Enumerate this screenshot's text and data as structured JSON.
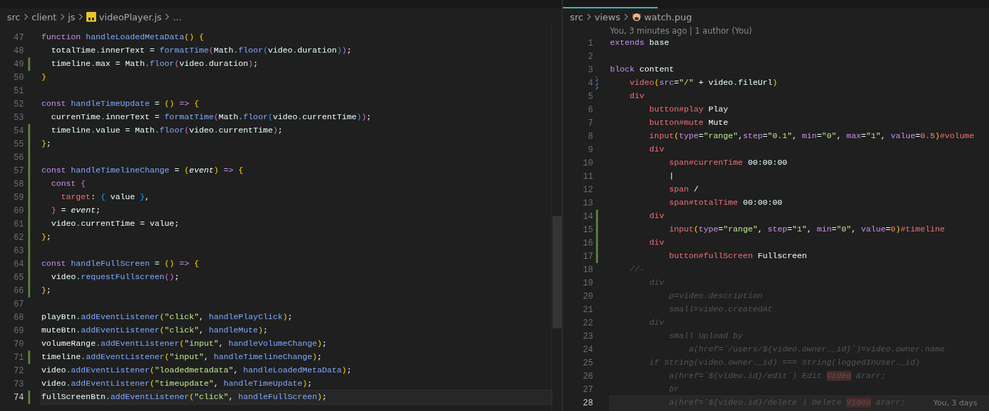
{
  "panes": [
    {
      "breadcrumbs": [
        {
          "label": "src",
          "kind": "folder"
        },
        {
          "label": "client",
          "kind": "folder"
        },
        {
          "label": "js",
          "kind": "folder"
        },
        {
          "label": "videoPlayer.js",
          "kind": "js-file"
        },
        {
          "label": "...",
          "kind": "more"
        }
      ],
      "lines": [
        {
          "number": "47",
          "kind": "plain",
          "current": false,
          "tokens": [
            {
              "text": "function ",
              "kind": "kw"
            },
            {
              "text": "handleLoadedMetaData",
              "kind": "fn"
            },
            {
              "text": "() {",
              "kind": "b1"
            }
          ]
        },
        {
          "number": "48",
          "kind": "plain",
          "current": false,
          "tokens": [
            {
              "text": "  totalTime",
              "kind": "v"
            },
            {
              "text": ".",
              "kind": "p"
            },
            {
              "text": "innerText = ",
              "kind": "v"
            },
            {
              "text": "formatTime",
              "kind": "fn"
            },
            {
              "text": "(",
              "kind": "b2"
            },
            {
              "text": "Math",
              "kind": "v"
            },
            {
              "text": ".",
              "kind": "p"
            },
            {
              "text": "floor",
              "kind": "fn"
            },
            {
              "text": "(",
              "kind": "b3"
            },
            {
              "text": "video",
              "kind": "v"
            },
            {
              "text": ".",
              "kind": "p"
            },
            {
              "text": "duration",
              "kind": "v"
            },
            {
              "text": ")",
              "kind": "b3"
            },
            {
              "text": ")",
              "kind": "b2"
            },
            {
              "text": ";",
              "kind": "v"
            }
          ]
        },
        {
          "number": "49",
          "kind": "modified",
          "current": false,
          "tokens": [
            {
              "text": "  timeline",
              "kind": "v"
            },
            {
              "text": ".",
              "kind": "p"
            },
            {
              "text": "max = Math",
              "kind": "v"
            },
            {
              "text": ".",
              "kind": "p"
            },
            {
              "text": "floor",
              "kind": "fn"
            },
            {
              "text": "(",
              "kind": "b2"
            },
            {
              "text": "video",
              "kind": "v"
            },
            {
              "text": ".",
              "kind": "p"
            },
            {
              "text": "duration",
              "kind": "v"
            },
            {
              "text": ")",
              "kind": "b2"
            },
            {
              "text": ";",
              "kind": "v"
            }
          ]
        },
        {
          "number": "50",
          "kind": "plain",
          "current": false,
          "tokens": [
            {
              "text": "}",
              "kind": "b1"
            }
          ]
        },
        {
          "number": "51",
          "kind": "plain",
          "current": false
        },
        {
          "number": "52",
          "kind": "plain",
          "current": false,
          "tokens": [
            {
              "text": "const ",
              "kind": "kw"
            },
            {
              "text": "handleTimeUpdate",
              "kind": "fn"
            },
            {
              "text": " = ",
              "kind": "v"
            },
            {
              "text": "()",
              "kind": "b1"
            },
            {
              "text": " => ",
              "kind": "kw"
            },
            {
              "text": "{",
              "kind": "b1"
            }
          ]
        },
        {
          "number": "53",
          "kind": "plain",
          "current": false,
          "tokens": [
            {
              "text": "  currenTime",
              "kind": "v"
            },
            {
              "text": ".",
              "kind": "p"
            },
            {
              "text": "innerText = ",
              "kind": "v"
            },
            {
              "text": "formatTime",
              "kind": "fn"
            },
            {
              "text": "(",
              "kind": "b2"
            },
            {
              "text": "Math",
              "kind": "v"
            },
            {
              "text": ".",
              "kind": "p"
            },
            {
              "text": "floor",
              "kind": "fn"
            },
            {
              "text": "(",
              "kind": "b3"
            },
            {
              "text": "video",
              "kind": "v"
            },
            {
              "text": ".",
              "kind": "p"
            },
            {
              "text": "currentTime",
              "kind": "v"
            },
            {
              "text": ")",
              "kind": "b3"
            },
            {
              "text": ")",
              "kind": "b2"
            },
            {
              "text": ";",
              "kind": "v"
            }
          ]
        },
        {
          "number": "54",
          "kind": "modified",
          "current": false,
          "tokens": [
            {
              "text": "  timeline",
              "kind": "v"
            },
            {
              "text": ".",
              "kind": "p"
            },
            {
              "text": "value = Math",
              "kind": "v"
            },
            {
              "text": ".",
              "kind": "p"
            },
            {
              "text": "floor",
              "kind": "fn"
            },
            {
              "text": "(",
              "kind": "b2"
            },
            {
              "text": "video",
              "kind": "v"
            },
            {
              "text": ".",
              "kind": "p"
            },
            {
              "text": "currentTime",
              "kind": "v"
            },
            {
              "text": ")",
              "kind": "b2"
            },
            {
              "text": ";",
              "kind": "v"
            }
          ]
        },
        {
          "number": "55",
          "kind": "modified",
          "current": false,
          "tokens": [
            {
              "text": "}",
              "kind": "b1"
            },
            {
              "text": ";",
              "kind": "v"
            }
          ]
        },
        {
          "number": "56",
          "kind": "modified",
          "current": false
        },
        {
          "number": "57",
          "kind": "modified",
          "current": false,
          "tokens": [
            {
              "text": "const ",
              "kind": "kw"
            },
            {
              "text": "handleTimelineChange",
              "kind": "fn"
            },
            {
              "text": " = ",
              "kind": "v"
            },
            {
              "text": "(",
              "kind": "b1"
            },
            {
              "text": "event",
              "kind": "it"
            },
            {
              "text": ")",
              "kind": "b1"
            },
            {
              "text": " => ",
              "kind": "kw"
            },
            {
              "text": "{",
              "kind": "b1"
            }
          ]
        },
        {
          "number": "58",
          "kind": "modified",
          "current": false,
          "tokens": [
            {
              "text": "  const ",
              "kind": "kw"
            },
            {
              "text": "{",
              "kind": "b2"
            }
          ]
        },
        {
          "number": "59",
          "kind": "modified",
          "current": false,
          "tokens": [
            {
              "text": "    target",
              "kind": "prop"
            },
            {
              "text": ": ",
              "kind": "v"
            },
            {
              "text": "{",
              "kind": "b3"
            },
            {
              "text": " value ",
              "kind": "v"
            },
            {
              "text": "}",
              "kind": "b3"
            },
            {
              "text": ",",
              "kind": "v"
            }
          ]
        },
        {
          "number": "60",
          "kind": "modified",
          "current": false,
          "tokens": [
            {
              "text": "  }",
              "kind": "b2"
            },
            {
              "text": " = ",
              "kind": "v"
            },
            {
              "text": "event",
              "kind": "it"
            },
            {
              "text": ";",
              "kind": "v"
            }
          ]
        },
        {
          "number": "61",
          "kind": "modified",
          "current": false,
          "tokens": [
            {
              "text": "  video",
              "kind": "v"
            },
            {
              "text": ".",
              "kind": "p"
            },
            {
              "text": "currentTime = value;",
              "kind": "v"
            }
          ]
        },
        {
          "number": "62",
          "kind": "modified",
          "current": false,
          "tokens": [
            {
              "text": "}",
              "kind": "b1"
            },
            {
              "text": ";",
              "kind": "v"
            }
          ]
        },
        {
          "number": "63",
          "kind": "modified",
          "current": false
        },
        {
          "number": "64",
          "kind": "modified",
          "current": false,
          "tokens": [
            {
              "text": "const ",
              "kind": "kw"
            },
            {
              "text": "handleFullScreen",
              "kind": "fn"
            },
            {
              "text": " = ",
              "kind": "v"
            },
            {
              "text": "()",
              "kind": "b1"
            },
            {
              "text": " => ",
              "kind": "kw"
            },
            {
              "text": "{",
              "kind": "b1"
            }
          ]
        },
        {
          "number": "65",
          "kind": "modified",
          "current": false,
          "tokens": [
            {
              "text": "  video",
              "kind": "v"
            },
            {
              "text": ".",
              "kind": "p"
            },
            {
              "text": "requestFullscreen",
              "kind": "fn"
            },
            {
              "text": "()",
              "kind": "b2"
            },
            {
              "text": ";",
              "kind": "v"
            }
          ]
        },
        {
          "number": "66",
          "kind": "modified",
          "current": false,
          "tokens": [
            {
              "text": "}",
              "kind": "b1"
            },
            {
              "text": ";",
              "kind": "v"
            }
          ]
        },
        {
          "number": "67",
          "kind": "plain",
          "current": false
        },
        {
          "number": "68",
          "kind": "plain",
          "current": false,
          "tokens": [
            {
              "text": "playBtn",
              "kind": "v"
            },
            {
              "text": ".",
              "kind": "p"
            },
            {
              "text": "addEventListener",
              "kind": "fn"
            },
            {
              "text": "(",
              "kind": "b1"
            },
            {
              "text": "\"click\"",
              "kind": "s"
            },
            {
              "text": ", ",
              "kind": "v"
            },
            {
              "text": "handlePlayClick",
              "kind": "fn"
            },
            {
              "text": ")",
              "kind": "b1"
            },
            {
              "text": ";",
              "kind": "v"
            }
          ]
        },
        {
          "number": "69",
          "kind": "plain",
          "current": false,
          "tokens": [
            {
              "text": "muteBtn",
              "kind": "v"
            },
            {
              "text": ".",
              "kind": "p"
            },
            {
              "text": "addEventListener",
              "kind": "fn"
            },
            {
              "text": "(",
              "kind": "b1"
            },
            {
              "text": "\"click\"",
              "kind": "s"
            },
            {
              "text": ", ",
              "kind": "v"
            },
            {
              "text": "handleMute",
              "kind": "fn"
            },
            {
              "text": ")",
              "kind": "b1"
            },
            {
              "text": ";",
              "kind": "v"
            }
          ]
        },
        {
          "number": "70",
          "kind": "plain",
          "current": false,
          "tokens": [
            {
              "text": "volumeRange",
              "kind": "v"
            },
            {
              "text": ".",
              "kind": "p"
            },
            {
              "text": "addEventListener",
              "kind": "fn"
            },
            {
              "text": "(",
              "kind": "b1"
            },
            {
              "text": "\"input\"",
              "kind": "s"
            },
            {
              "text": ", ",
              "kind": "v"
            },
            {
              "text": "handleVolumeChange",
              "kind": "fn"
            },
            {
              "text": ")",
              "kind": "b1"
            },
            {
              "text": ";",
              "kind": "v"
            }
          ]
        },
        {
          "number": "71",
          "kind": "modified",
          "current": false,
          "tokens": [
            {
              "text": "timeline",
              "kind": "v"
            },
            {
              "text": ".",
              "kind": "p"
            },
            {
              "text": "addEventListener",
              "kind": "fn"
            },
            {
              "text": "(",
              "kind": "b1"
            },
            {
              "text": "\"input\"",
              "kind": "s"
            },
            {
              "text": ", ",
              "kind": "v"
            },
            {
              "text": "handleTimelineChange",
              "kind": "fn"
            },
            {
              "text": ")",
              "kind": "b1"
            },
            {
              "text": ";",
              "kind": "v"
            }
          ]
        },
        {
          "number": "72",
          "kind": "plain",
          "current": false,
          "tokens": [
            {
              "text": "video",
              "kind": "v"
            },
            {
              "text": ".",
              "kind": "p"
            },
            {
              "text": "addEventListener",
              "kind": "fn"
            },
            {
              "text": "(",
              "kind": "b1"
            },
            {
              "text": "\"loadedmetadata\"",
              "kind": "s"
            },
            {
              "text": ", ",
              "kind": "v"
            },
            {
              "text": "handleLoadedMetaData",
              "kind": "fn"
            },
            {
              "text": ")",
              "kind": "b1"
            },
            {
              "text": ";",
              "kind": "v"
            }
          ]
        },
        {
          "number": "73",
          "kind": "plain",
          "current": false,
          "tokens": [
            {
              "text": "video",
              "kind": "v"
            },
            {
              "text": ".",
              "kind": "p"
            },
            {
              "text": "addEventListener",
              "kind": "fn"
            },
            {
              "text": "(",
              "kind": "b1"
            },
            {
              "text": "\"timeupdate\"",
              "kind": "s"
            },
            {
              "text": ", ",
              "kind": "v"
            },
            {
              "text": "handleTimeUpdate",
              "kind": "fn"
            },
            {
              "text": ")",
              "kind": "b1"
            },
            {
              "text": ";",
              "kind": "v"
            }
          ]
        },
        {
          "number": "74",
          "kind": "modified",
          "current": true,
          "tokens": [
            {
              "text": "fullScreenBtn",
              "kind": "v"
            },
            {
              "text": ".",
              "kind": "p"
            },
            {
              "text": "addEventListener",
              "kind": "fn"
            },
            {
              "text": "(",
              "kind": "b1"
            },
            {
              "text": "\"click\"",
              "kind": "s"
            },
            {
              "text": ", ",
              "kind": "v"
            },
            {
              "text": "handleFullScreen",
              "kind": "fn"
            },
            {
              "text": ")",
              "kind": "b1"
            },
            {
              "text": ";",
              "kind": "v"
            }
          ]
        }
      ]
    },
    {
      "breadcrumbs": [
        {
          "label": "src",
          "kind": "folder"
        },
        {
          "label": "views",
          "kind": "folder"
        },
        {
          "label": "watch.pug",
          "kind": "pug-file"
        }
      ],
      "blame_header": "You, 3 minutes ago | 1 author (You)",
      "lines": [
        {
          "number": "1",
          "kind": "plain",
          "current": false,
          "tokens": [
            {
              "text": "extends ",
              "kind": "kw"
            },
            {
              "text": "base",
              "kind": "v"
            }
          ]
        },
        {
          "number": "2",
          "kind": "plain",
          "current": false
        },
        {
          "number": "3",
          "kind": "plain",
          "current": false,
          "tokens": [
            {
              "text": "block ",
              "kind": "kw"
            },
            {
              "text": "content",
              "kind": "v"
            }
          ]
        },
        {
          "number": "4",
          "kind": "dotted",
          "current": false,
          "tokens": [
            {
              "text": "    video",
              "kind": "tag"
            },
            {
              "text": "(",
              "kind": "b1"
            },
            {
              "text": "src",
              "kind": "attr"
            },
            {
              "text": "=",
              "kind": "v"
            },
            {
              "text": "\"/\"",
              "kind": "s"
            },
            {
              "text": " + video",
              "kind": "v"
            },
            {
              "text": ".",
              "kind": "p"
            },
            {
              "text": "fileUrl",
              "kind": "v"
            },
            {
              "text": ")",
              "kind": "b1"
            }
          ]
        },
        {
          "number": "5",
          "kind": "plain",
          "current": false,
          "tokens": [
            {
              "text": "    div",
              "kind": "tag"
            }
          ]
        },
        {
          "number": "6",
          "kind": "plain",
          "current": false,
          "tokens": [
            {
              "text": "        button#play ",
              "kind": "tag"
            },
            {
              "text": "Play",
              "kind": "v"
            }
          ]
        },
        {
          "number": "7",
          "kind": "plain",
          "current": false,
          "tokens": [
            {
              "text": "        button#mute ",
              "kind": "tag"
            },
            {
              "text": "Mute",
              "kind": "v"
            }
          ]
        },
        {
          "number": "8",
          "kind": "plain",
          "current": false,
          "tokens": [
            {
              "text": "        input",
              "kind": "tag"
            },
            {
              "text": "(",
              "kind": "b1"
            },
            {
              "text": "type",
              "kind": "attr"
            },
            {
              "text": "=",
              "kind": "v"
            },
            {
              "text": "\"range\"",
              "kind": "s"
            },
            {
              "text": ",",
              "kind": "v"
            },
            {
              "text": "step",
              "kind": "attr"
            },
            {
              "text": "=",
              "kind": "v"
            },
            {
              "text": "\"0.1\"",
              "kind": "s"
            },
            {
              "text": ", ",
              "kind": "v"
            },
            {
              "text": "min",
              "kind": "attr"
            },
            {
              "text": "=",
              "kind": "v"
            },
            {
              "text": "\"0\"",
              "kind": "s"
            },
            {
              "text": ", ",
              "kind": "v"
            },
            {
              "text": "max",
              "kind": "attr"
            },
            {
              "text": "=",
              "kind": "v"
            },
            {
              "text": "\"1\"",
              "kind": "s"
            },
            {
              "text": ", ",
              "kind": "v"
            },
            {
              "text": "value",
              "kind": "attr"
            },
            {
              "text": "=",
              "kind": "v"
            },
            {
              "text": "0.5",
              "kind": "num"
            },
            {
              "text": ")",
              "kind": "b1"
            },
            {
              "text": "#volume",
              "kind": "tag"
            }
          ]
        },
        {
          "number": "9",
          "kind": "plain",
          "current": false,
          "tokens": [
            {
              "text": "        div",
              "kind": "tag"
            }
          ]
        },
        {
          "number": "10",
          "kind": "plain",
          "current": false,
          "tokens": [
            {
              "text": "            span#currenTime ",
              "kind": "tag"
            },
            {
              "text": "00:00:00",
              "kind": "v"
            }
          ]
        },
        {
          "number": "11",
          "kind": "plain",
          "current": false,
          "tokens": [
            {
              "text": "            |",
              "kind": "v"
            }
          ]
        },
        {
          "number": "12",
          "kind": "plain",
          "current": false,
          "tokens": [
            {
              "text": "            span ",
              "kind": "tag"
            },
            {
              "text": "/",
              "kind": "v"
            }
          ]
        },
        {
          "number": "13",
          "kind": "plain",
          "current": false,
          "tokens": [
            {
              "text": "            span#totalTime ",
              "kind": "tag"
            },
            {
              "text": "00:00:00",
              "kind": "v"
            }
          ]
        },
        {
          "number": "14",
          "kind": "modified",
          "current": false,
          "tokens": [
            {
              "text": "        div",
              "kind": "tag"
            }
          ]
        },
        {
          "number": "15",
          "kind": "modified",
          "current": false,
          "tokens": [
            {
              "text": "            input",
              "kind": "tag"
            },
            {
              "text": "(",
              "kind": "b1"
            },
            {
              "text": "type",
              "kind": "attr"
            },
            {
              "text": "=",
              "kind": "v"
            },
            {
              "text": "\"range\"",
              "kind": "s"
            },
            {
              "text": ", ",
              "kind": "v"
            },
            {
              "text": "step",
              "kind": "attr"
            },
            {
              "text": "=",
              "kind": "v"
            },
            {
              "text": "\"1\"",
              "kind": "s"
            },
            {
              "text": ", ",
              "kind": "v"
            },
            {
              "text": "min",
              "kind": "attr"
            },
            {
              "text": "=",
              "kind": "v"
            },
            {
              "text": "\"0\"",
              "kind": "s"
            },
            {
              "text": ", ",
              "kind": "v"
            },
            {
              "text": "value",
              "kind": "attr"
            },
            {
              "text": "=",
              "kind": "v"
            },
            {
              "text": "0",
              "kind": "num"
            },
            {
              "text": ")",
              "kind": "b1"
            },
            {
              "text": "#timeline",
              "kind": "tag"
            }
          ]
        },
        {
          "number": "16",
          "kind": "modified",
          "current": false,
          "tokens": [
            {
              "text": "        div",
              "kind": "tag"
            }
          ]
        },
        {
          "number": "17",
          "kind": "modified",
          "current": false,
          "tokens": [
            {
              "text": "            button#fullScreen ",
              "kind": "tag"
            },
            {
              "text": "Fullscreen",
              "kind": "v"
            }
          ]
        },
        {
          "number": "18",
          "kind": "plain",
          "current": false,
          "tokens": [
            {
              "text": "    //-",
              "kind": "c"
            }
          ]
        },
        {
          "number": "19",
          "kind": "plain",
          "current": false,
          "tokens": [
            {
              "text": "        div",
              "kind": "c"
            }
          ]
        },
        {
          "number": "20",
          "kind": "plain",
          "current": false,
          "tokens": [
            {
              "text": "            p=video.description",
              "kind": "c"
            }
          ]
        },
        {
          "number": "21",
          "kind": "plain",
          "current": false,
          "tokens": [
            {
              "text": "            small=video.createdAt",
              "kind": "c"
            }
          ]
        },
        {
          "number": "22",
          "kind": "plain",
          "current": false,
          "tokens": [
            {
              "text": "        div",
              "kind": "c"
            }
          ]
        },
        {
          "number": "23",
          "kind": "plain",
          "current": false,
          "tokens": [
            {
              "text": "            small Upload by",
              "kind": "c"
            }
          ]
        },
        {
          "number": "24",
          "kind": "plain",
          "current": false,
          "tokens": [
            {
              "text": "                a(href=`/users/${video.owner._id}`)=video.owner.name",
              "kind": "c"
            }
          ]
        },
        {
          "number": "25",
          "kind": "plain",
          "current": false,
          "tokens": [
            {
              "text": "        if String(video.owner._id) === String(loggedInUser._id)",
              "kind": "c"
            }
          ]
        },
        {
          "number": "26",
          "kind": "plain",
          "current": false,
          "tokens": [
            {
              "text": "            a(href=`${video.id}/edit`) Edit ",
              "kind": "c"
            },
            {
              "text": "Video",
              "kind": "ch"
            },
            {
              "text": " &rarr;",
              "kind": "c"
            }
          ]
        },
        {
          "number": "27",
          "kind": "plain",
          "current": false,
          "tokens": [
            {
              "text": "            br",
              "kind": "c"
            }
          ]
        },
        {
          "number": "28",
          "kind": "plain",
          "current": true,
          "blame": "You, 3 days",
          "tokens": [
            {
              "text": "            a(href=`${video.id}/delete`) Delete ",
              "kind": "c"
            },
            {
              "text": "Video",
              "kind": "ch"
            },
            {
              "text": " &rarr;",
              "kind": "c"
            }
          ]
        }
      ]
    }
  ]
}
